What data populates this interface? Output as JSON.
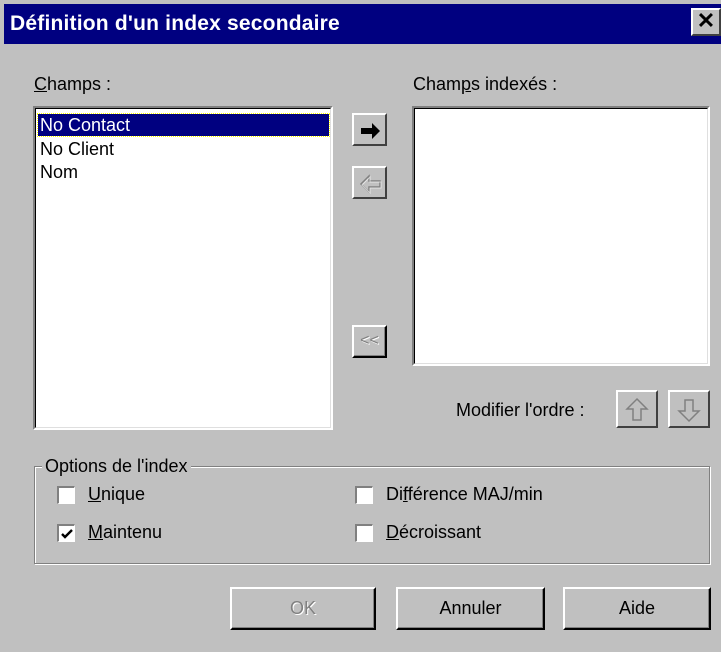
{
  "dialog": {
    "title": "Définition d'un index secondaire",
    "close_glyph": "✕"
  },
  "fields": {
    "label_prefix": "C",
    "label_rest": "hamps :",
    "items": [
      "No Contact",
      "No Client",
      "Nom"
    ],
    "selected_index": 0
  },
  "indexed": {
    "label_pre": "Cham",
    "label_u": "p",
    "label_post": "s indexés :",
    "items": []
  },
  "order": {
    "label": "Modifier l'ordre :",
    "up_icon": "arrow-up-icon",
    "down_icon": "arrow-down-icon"
  },
  "transfer": {
    "add_icon": "arrow-right-icon",
    "remove_icon": "arrow-left-icon",
    "remove_all_label": "<<"
  },
  "options": {
    "legend": "Options de l'index",
    "unique": {
      "u": "U",
      "rest": "nique",
      "checked": false
    },
    "maintenu": {
      "u": "M",
      "rest": "aintenu",
      "checked": true
    },
    "case": {
      "pre": "Di",
      "u": "f",
      "rest": "férence MAJ/min",
      "checked": false
    },
    "desc": {
      "u": "D",
      "rest": "écroissant",
      "checked": false
    }
  },
  "buttons": {
    "ok": "OK",
    "cancel": "Annuler",
    "help": "Aide"
  }
}
